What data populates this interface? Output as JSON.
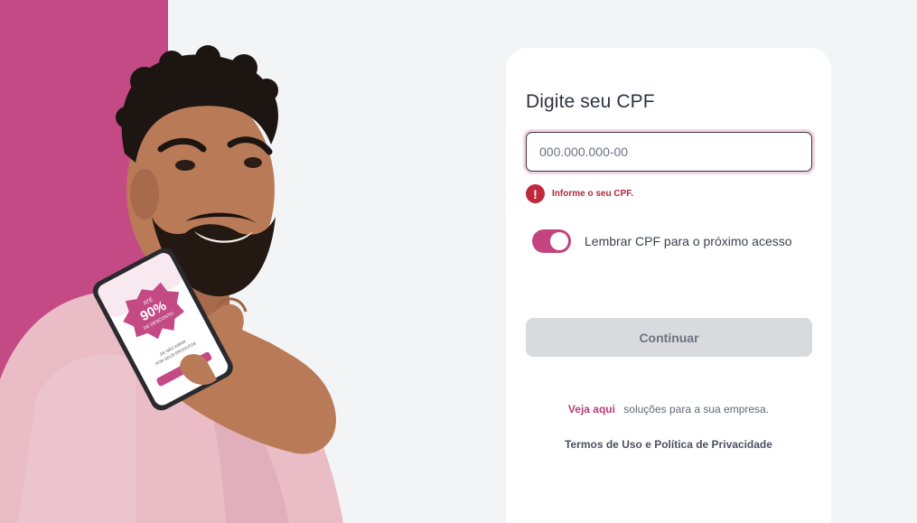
{
  "hero": {
    "phone_screen": {
      "small_top": "ATÉ",
      "percent": "90%",
      "discount": "DE DESCONTO",
      "line1": "DE NÃO ABRIR",
      "line2": "POR SEUS PRODUTOS"
    }
  },
  "login": {
    "title": "Digite seu CPF",
    "cpf_placeholder": "000.000.000-00",
    "cpf_value": "",
    "error_icon_glyph": "!",
    "error_message": "Informe o seu CPF.",
    "remember_label": "Lembrar CPF para o próximo acesso",
    "remember_enabled": true,
    "continue_label": "Continuar"
  },
  "footer": {
    "promo_link": "Veja aqui",
    "promo_text": "soluções para a sua empresa.",
    "terms_link": "Termos de Uso e Política de Privacidade"
  },
  "colors": {
    "brand_pink": "#c44a86",
    "error_red": "#c0283c",
    "page_bg": "#f3f4f6",
    "button_disabled": "#d9dade"
  }
}
